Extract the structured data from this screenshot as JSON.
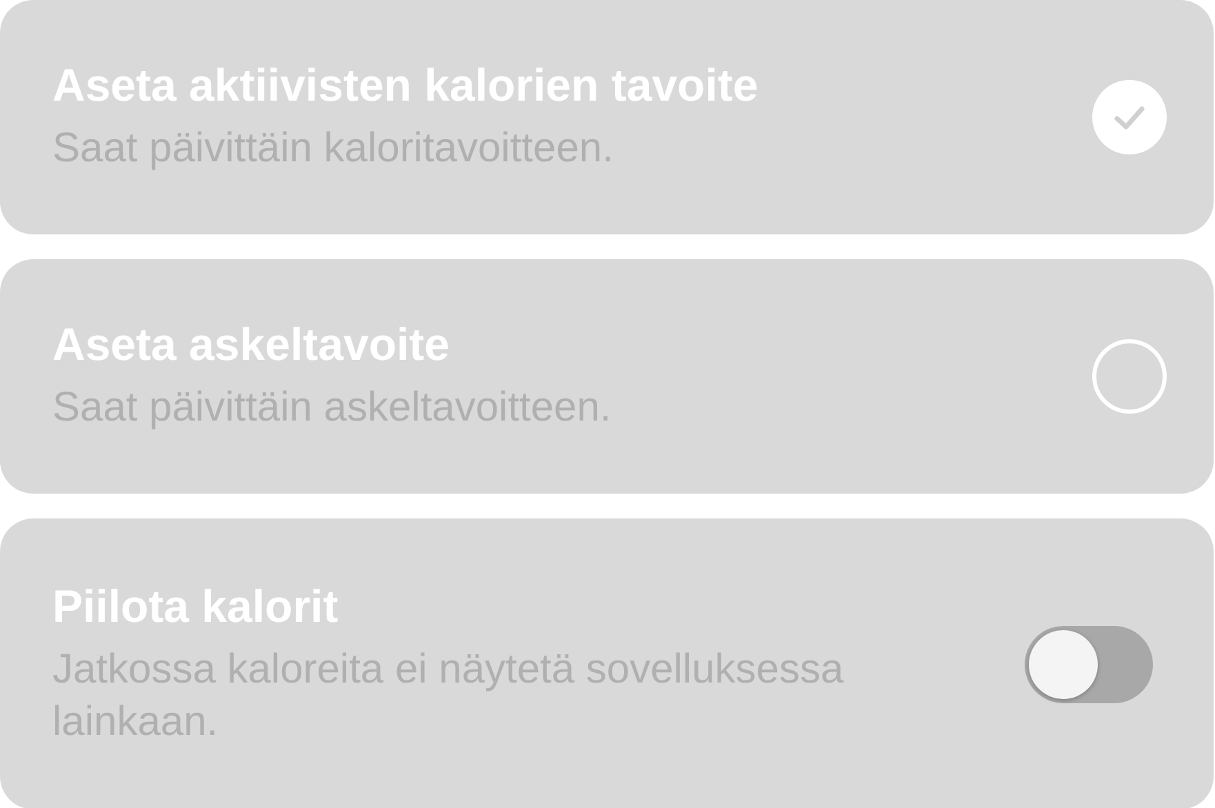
{
  "options": [
    {
      "kind": "radio",
      "title": "Aseta aktiivisten kalorien tavoite",
      "subtitle": "Saat päivittäin kaloritavoitteen.",
      "selected": true
    },
    {
      "kind": "radio",
      "title": "Aseta askeltavoite",
      "subtitle": "Saat päivittäin askeltavoitteen.",
      "selected": false
    },
    {
      "kind": "toggle",
      "title": "Piilota kalorit",
      "subtitle": "Jatkossa kaloreita ei näytetä sovelluksessa lainkaan.",
      "on": false
    }
  ]
}
